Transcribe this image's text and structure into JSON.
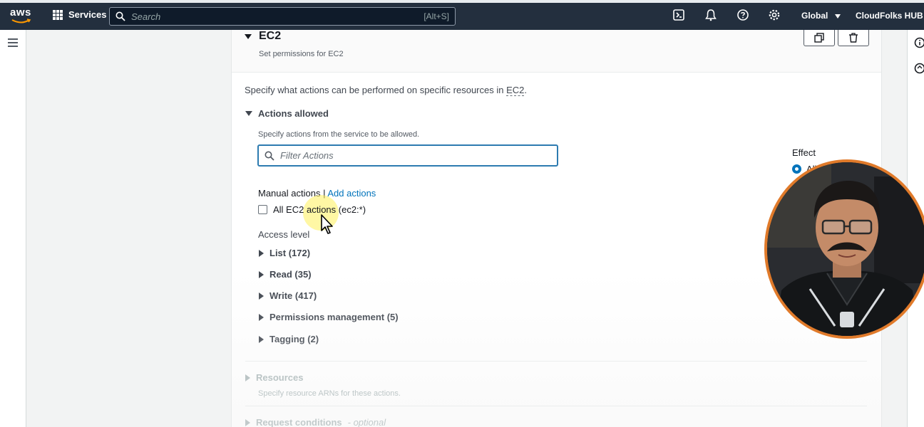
{
  "topnav": {
    "logo": "aws",
    "services_label": "Services",
    "search_placeholder": "Search",
    "search_shortcut": "[Alt+S]",
    "region_label": "Global",
    "account_label": "CloudFolks HUB"
  },
  "policy": {
    "service_title": "EC2",
    "service_subtitle": "Set permissions for EC2",
    "specify_prefix": "Specify what actions can be performed on specific resources in ",
    "specify_service": "EC2",
    "specify_suffix": ".",
    "actions_allowed_label": "Actions allowed",
    "actions_allowed_hint": "Specify actions from the service to be allowed.",
    "filter_placeholder": "Filter Actions",
    "manual_actions_label": "Manual actions",
    "separator": "|",
    "add_actions_link": "Add actions",
    "all_actions_label": "All EC2 actions (ec2:*)",
    "access_level_label": "Access level",
    "access_levels": [
      {
        "label": "List (172)"
      },
      {
        "label": "Read (35)"
      },
      {
        "label": "Write (417)"
      },
      {
        "label": "Permissions management (5)"
      },
      {
        "label": "Tagging (2)"
      }
    ],
    "resources_label": "Resources",
    "resources_hint": "Specify resource ARNs for these actions.",
    "request_conditions_label": "Request conditions",
    "request_conditions_optional": "- optional",
    "effect_label": "Effect",
    "effect_option": "All"
  },
  "icons": [
    "aws-logo",
    "services-grid-icon",
    "search-icon",
    "cloudshell-icon",
    "notifications-icon",
    "help-icon",
    "settings-icon",
    "menu-icon",
    "duplicate-icon",
    "trash-icon",
    "info-icon",
    "feedback-icon"
  ],
  "colors": {
    "nav_bg": "#232f3e",
    "link": "#0073bb",
    "focus_border": "#2d7bb0",
    "webcam_border": "#e07a2a"
  }
}
